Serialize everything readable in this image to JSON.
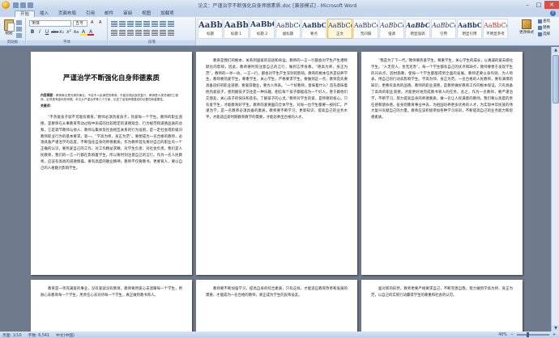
{
  "window": {
    "title": "论文：严谨治学不断强化自身师德素质.doc [兼容模式] - Microsoft Word",
    "controls": [
      "–",
      "□",
      "✕"
    ]
  },
  "tabs": [
    "开始",
    "插入",
    "页面布局",
    "引用",
    "邮件",
    "审阅",
    "视图",
    "加载项"
  ],
  "active_tab": "开始",
  "ribbon": {
    "clipboard": {
      "paste_label": "粘贴",
      "group_label": "剪贴板"
    },
    "font": {
      "font_name": "宋体",
      "font_size": "五号",
      "group_label": "字体",
      "format_buttons": [
        "B",
        "I",
        "U",
        "abe",
        "x₂",
        "x²",
        "Aa",
        "A",
        "A"
      ]
    },
    "paragraph": {
      "group_label": "段落"
    },
    "styles": {
      "group_label": "样式",
      "items": [
        {
          "sample": "AaBbCcDd",
          "name": "标题",
          "kind": "big"
        },
        {
          "sample": "AaBbCcDd",
          "name": "标题 1",
          "kind": "big"
        },
        {
          "sample": "AaBbC",
          "name": "标题 2",
          "kind": "mid"
        },
        {
          "sample": "AaBbCcDd",
          "name": "副标题",
          "kind": "normal"
        },
        {
          "sample": "AaBbCcDd",
          "name": "要点",
          "kind": "normal"
        },
        {
          "sample": "AaBbCcDd",
          "name": "正文",
          "kind": "selected"
        },
        {
          "sample": "AaBbCcDd",
          "name": "无间隔",
          "kind": "normal"
        },
        {
          "sample": "AaBbCcDd",
          "name": "强调",
          "kind": "normal"
        },
        {
          "sample": "AaBbCcDd",
          "name": "明显强调",
          "kind": "normal"
        },
        {
          "sample": "AaBbCcDd",
          "name": "引用",
          "kind": "normal"
        },
        {
          "sample": "AaBbCcDd",
          "name": "明显引用",
          "kind": "normal"
        },
        {
          "sample": "AaBbCcDd",
          "name": "不明显参考",
          "kind": "red"
        },
        {
          "sample": "AaBbCcD",
          "name": "明显参考",
          "kind": "red"
        }
      ],
      "change_styles": "更改样式"
    },
    "editing": {
      "items": [
        "查找",
        "替换",
        "选择"
      ],
      "group_label": "编辑"
    }
  },
  "pages": [
    {
      "title": "严谨治学不断强化自身师德素质",
      "abstract_label": "内容摘要：",
      "abstract": "教育事业是光荣的事业，不给予人民满意的教育，不能实现民族的复兴。教师是人类灵魂的工程师，必须具有高尚的师德。本文从严谨治学等几个方面，论述了加强师德建设的必要性和重要性。",
      "keywords": "关键词：",
      "body": "“不热爱孩子就不可能有教育。”教师必须热爱孩子，热爱每一个学生。教师的职业道德，是教师在从事教育劳动过程中形成的比较稳定的道德观念、行为规范和道德品质的总和，它是调节教师与他人、教师与集体及社会相互关系的行为准则，是一定社会或阶级对教师职业行为的基本要求。第一、“学高为师，身正为范”。要想成为一名合格的教师，必须具备严谨治学的态度，不断强化自身的师德素质。作为教师首先要对自己的职业有一个正确的认识，要热爱自己的工作，对工作精益求精，对学生负责，对社会负责。我们是人民教师，我们的一言一行都在影响着学生，所以要时刻注意自己的言行。作为一名人民教师，应该有高尚的道德情操，要有高度的敬业精神。教师不仅要教书，更要育人，要以自己的人格魅力影响学生。"
    },
    {
      "body": "教育是我们的根本，关系到国家的前途和命运。教师的一言一行都会对学生产生潜移默化的影响，因此，教师要时刻注意自己的言行，做到言传身教。“德高为师，身正为范”，教师的一举一动，一言一行，都会对学生产生深刻的影响。教育的根本任务是培养学生，教师要热爱学生，尊重学生，关心学生，严格要求学生。要做到这一点，教师首先要具备良好的职业道德，要爱岗敬业，要为人师表。“一个好教师，意味着什么？首先意味着他热爱孩子，感到跟孩子交往是一种乐趣，相信每个孩子都能成为一个好人，善于跟他们交朋友，关心孩子的快乐和悲伤，了解孩子的心灵。”教师对学生的爱，是师德的核心。只有爱学生，才能教育好学生。教师的爱要面向全体学生，对每一位学生都要一视同仁。严谨治学，是一名教师必须具备的素质。教师要不断学习，更新知识，提高自己的业务水平，才能适应新时期教育教学的需要，才能培养出合格的人才。"
    },
    {
      "body": "“我是为了下一代。”教师要热爱学生，尊重学生，关心学生的成长，以真诚的爱去感化学生。“人无完人，金无足赤”。每一个学生都有自己的优点和缺点，教师要善于发现学生的闪光点，因材施教，使每一个学生都能得到全面的发展。教师还要以身作则，为人师表，用自己的行动去影响学生。学高为师，身正为范。一名合格的人民教师，要有渊博的知识，更要有高尚的品德。教师的职业道德，是教师做好教育工作的根本保证。只有具备了高尚的职业道德，才能更好地完成教书育人的任务。总之，作为一名教师，要严谨治学，不断学习，努力提高自身的师德素质，做一名让人民满意的教师。我们要以高度的责任感和使命感，投身到教育事业中去，为祖国培养更多优秀的人才，为实现中华民族的伟大复兴贡献自己的力量。教师应该积极参加各种学习培训，不断提高自己的业务能力和思想素质。"
    },
    {
      "body": "教育是一项充满爱的事业，没有爱就没有教育。教师要用爱心去温暖每一个学生，用耐心去教育每一个学生，用责任心去对待每一个学生，真正做到教书育人。"
    },
    {
      "body": "教师要不断加强学习，提高自身的综合素质，只有这样，才能适应教育改革和发展的需要，才能成为一名合格的教师，真正成为学生的良师益友。"
    },
    {
      "body": "面对新的形势，教师更要严格要求自己，不断完善自我，努力做到学高为师、身正为范，以自己的实际行动赢得学生的尊重和社会的认可。"
    }
  ],
  "status": {
    "page": "页面: 1/10",
    "words": "字数: 6,541",
    "language": "中文(中国)",
    "zoom": "40%"
  }
}
